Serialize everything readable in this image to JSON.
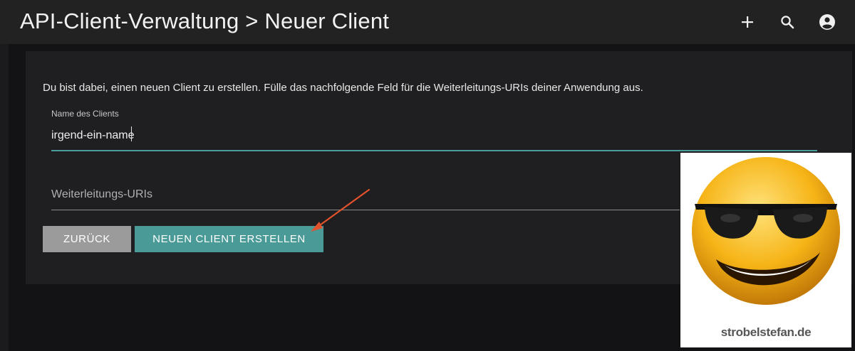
{
  "appbar": {
    "title": "API-Client-Verwaltung > Neuer Client",
    "actions": [
      {
        "icon": "plus-icon"
      },
      {
        "icon": "search-icon"
      },
      {
        "icon": "account-circle-icon"
      }
    ]
  },
  "form": {
    "intro": "Du bist dabei, einen neuen Client zu erstellen. Fülle das nachfolgende Feld für die Weiterleitungs-URIs deiner Anwendung aus.",
    "client_name": {
      "label": "Name des Clients",
      "value": "irgend-ein-name"
    },
    "redirect_uris": {
      "placeholder": "Weiterleitungs-URIs",
      "value": ""
    },
    "back_label": "ZURÜCK",
    "create_label": "NEUEN CLIENT ERSTELLEN"
  },
  "watermark": {
    "text": "strobelstefan.de"
  },
  "colors": {
    "appbar": "#222223",
    "background": "#131214",
    "card": "#1f1e20",
    "accent": "#4a9a98",
    "back_button": "#9b9b9b",
    "annotation_arrow": "#e0522b"
  }
}
